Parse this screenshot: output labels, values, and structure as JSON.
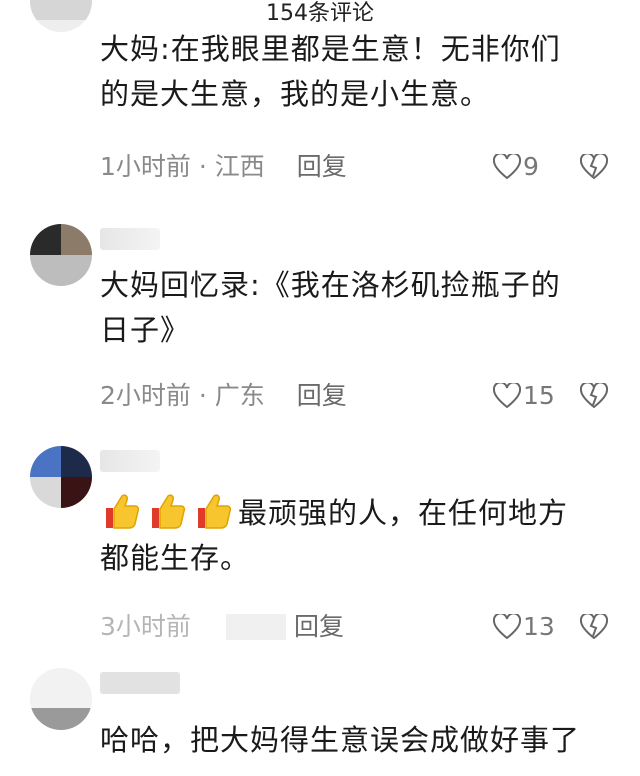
{
  "header": {
    "title": "154条评论"
  },
  "comments": [
    {
      "text_lines": [
        "大妈:在我眼里都是生意！无非你们",
        "的是大生意，我的是小生意。"
      ],
      "time": "1小时前",
      "location": "江西",
      "reply_label": "回复",
      "likes": "9"
    },
    {
      "text_lines": [
        "大妈回忆录:《我在洛杉矶捡瓶子的",
        "日子》"
      ],
      "time": "2小时前",
      "location": "广东",
      "reply_label": "回复",
      "likes": "15"
    },
    {
      "emoji": [
        "thumbs-up",
        "thumbs-up",
        "thumbs-up"
      ],
      "text_lines": [
        "最顽强的人，在任何地方",
        "都能生存。"
      ],
      "time": "3小时前",
      "reply_label": "回复",
      "likes": "13"
    },
    {
      "text_lines": [
        "哈哈，把大妈得生意误会成做好事了"
      ]
    }
  ],
  "colors": {
    "meta_gray": "#8a8a8a",
    "text": "#1a1a1a"
  }
}
